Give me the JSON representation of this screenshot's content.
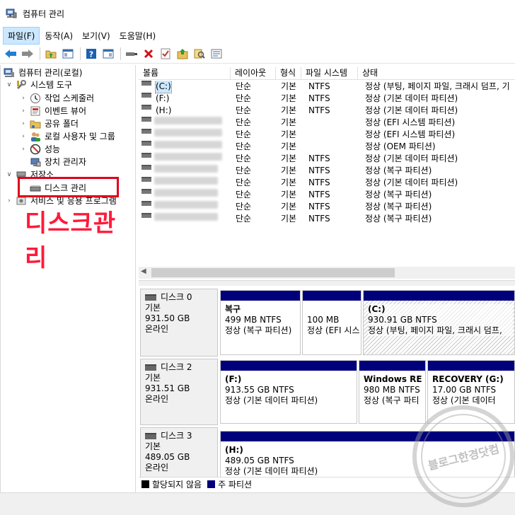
{
  "window": {
    "title": "컴퓨터 관리"
  },
  "menu": [
    {
      "label": "파일(F)"
    },
    {
      "label": "동작(A)"
    },
    {
      "label": "보기(V)"
    },
    {
      "label": "도움말(H)"
    }
  ],
  "toolbar": {
    "icons": [
      "back-arrow-icon",
      "forward-arrow-icon",
      "up-folder-icon",
      "show-hide-tree-icon",
      "help-icon",
      "show-pane-icon",
      "connect-icon",
      "delete-icon",
      "properties-icon",
      "export-icon",
      "search-icon",
      "list-icon"
    ]
  },
  "tree": {
    "root": "컴퓨터 관리(로컬)",
    "system_tools": "시스템 도구",
    "task_scheduler": "작업 스케줄러",
    "event_viewer": "이벤트 뷰어",
    "shared_folders": "공유 폴더",
    "local_users": "로컬 사용자 및 그룹",
    "performance": "성능",
    "device_manager": "장치 관리자",
    "storage": "저장소",
    "disk_management": "디스크 관리",
    "services": "서비스 및 응용 프로그램"
  },
  "annotation": {
    "text": "디스크관리"
  },
  "volume_list": {
    "columns": [
      "볼륨",
      "레이아웃",
      "형식",
      "파일 시스템",
      "상태"
    ],
    "rows": [
      {
        "volume": "(C:)",
        "layout": "단순",
        "type": "기본",
        "fs": "NTFS",
        "status": "정상 (부팅, 페이지 파일, 크래시 덤프, 기"
      },
      {
        "volume": "(F:)",
        "layout": "단순",
        "type": "기본",
        "fs": "NTFS",
        "status": "정상 (기본 데이터 파티션)"
      },
      {
        "volume": "(H:)",
        "layout": "단순",
        "type": "기본",
        "fs": "NTFS",
        "status": "정상 (기본 데이터 파티션)"
      },
      {
        "volume": "",
        "layout": "단순",
        "type": "기본",
        "fs": "",
        "status": "정상 (EFI 시스템 파티션)"
      },
      {
        "volume": "",
        "layout": "단순",
        "type": "기본",
        "fs": "",
        "status": "정상 (EFI 시스템 파티션)"
      },
      {
        "volume": "",
        "layout": "단순",
        "type": "기본",
        "fs": "",
        "status": "정상 (OEM 파티션)"
      },
      {
        "volume": "",
        "layout": "단순",
        "type": "기본",
        "fs": "NTFS",
        "status": "정상 (기본 데이터 파티션)"
      },
      {
        "volume": "",
        "layout": "단순",
        "type": "기본",
        "fs": "NTFS",
        "status": "정상 (복구 파티션)"
      },
      {
        "volume": "",
        "layout": "단순",
        "type": "기본",
        "fs": "NTFS",
        "status": "정상 (기본 데이터 파티션)"
      },
      {
        "volume": "",
        "layout": "단순",
        "type": "기본",
        "fs": "NTFS",
        "status": "정상 (복구 파티션)"
      },
      {
        "volume": "",
        "layout": "단순",
        "type": "기본",
        "fs": "NTFS",
        "status": "정상 (복구 파티션)"
      },
      {
        "volume": "",
        "layout": "단순",
        "type": "기본",
        "fs": "NTFS",
        "status": "정상 (복구 파티션)"
      }
    ]
  },
  "disks": [
    {
      "name": "디스크 0",
      "kind": "기본",
      "size": "931.50 GB",
      "state": "온라인",
      "partitions": [
        {
          "title": "복구",
          "line2": "499 MB NTFS",
          "line3": "정상 (복구 파티션)"
        },
        {
          "title": "",
          "line2": "100 MB",
          "line3": "정상 (EFI 시스"
        },
        {
          "title": "(C:)",
          "line2": "930.91 GB NTFS",
          "line3": "정상 (부팅, 페이지 파일, 크래시 덤프,"
        }
      ]
    },
    {
      "name": "디스크 2",
      "kind": "기본",
      "size": "931.51 GB",
      "state": "온라인",
      "partitions": [
        {
          "title": "(F:)",
          "line2": "913.55 GB NTFS",
          "line3": "정상 (기본 데이터 파티션)"
        },
        {
          "title": "Windows RE t",
          "line2": "980 MB NTFS",
          "line3": "정상 (복구 파티"
        },
        {
          "title": "RECOVERY  (G:)",
          "line2": "17.00 GB NTFS",
          "line3": "정상 (기본 데이터"
        }
      ]
    },
    {
      "name": "디스크 3",
      "kind": "기본",
      "size": "489.05 GB",
      "state": "온라인",
      "partitions": [
        {
          "title": "(H:)",
          "line2": "489.05 GB NTFS",
          "line3": "정상 (기본 데이터 파티션)"
        }
      ]
    }
  ],
  "legend": {
    "unallocated": "할당되지 않음",
    "primary": "주 파티션"
  },
  "watermark": {
    "text": "블로그한경닷컴"
  },
  "colors": {
    "partition_bar": "#00007a",
    "annotation": "#ff1a3a",
    "highlight_box": "#e0001a"
  }
}
